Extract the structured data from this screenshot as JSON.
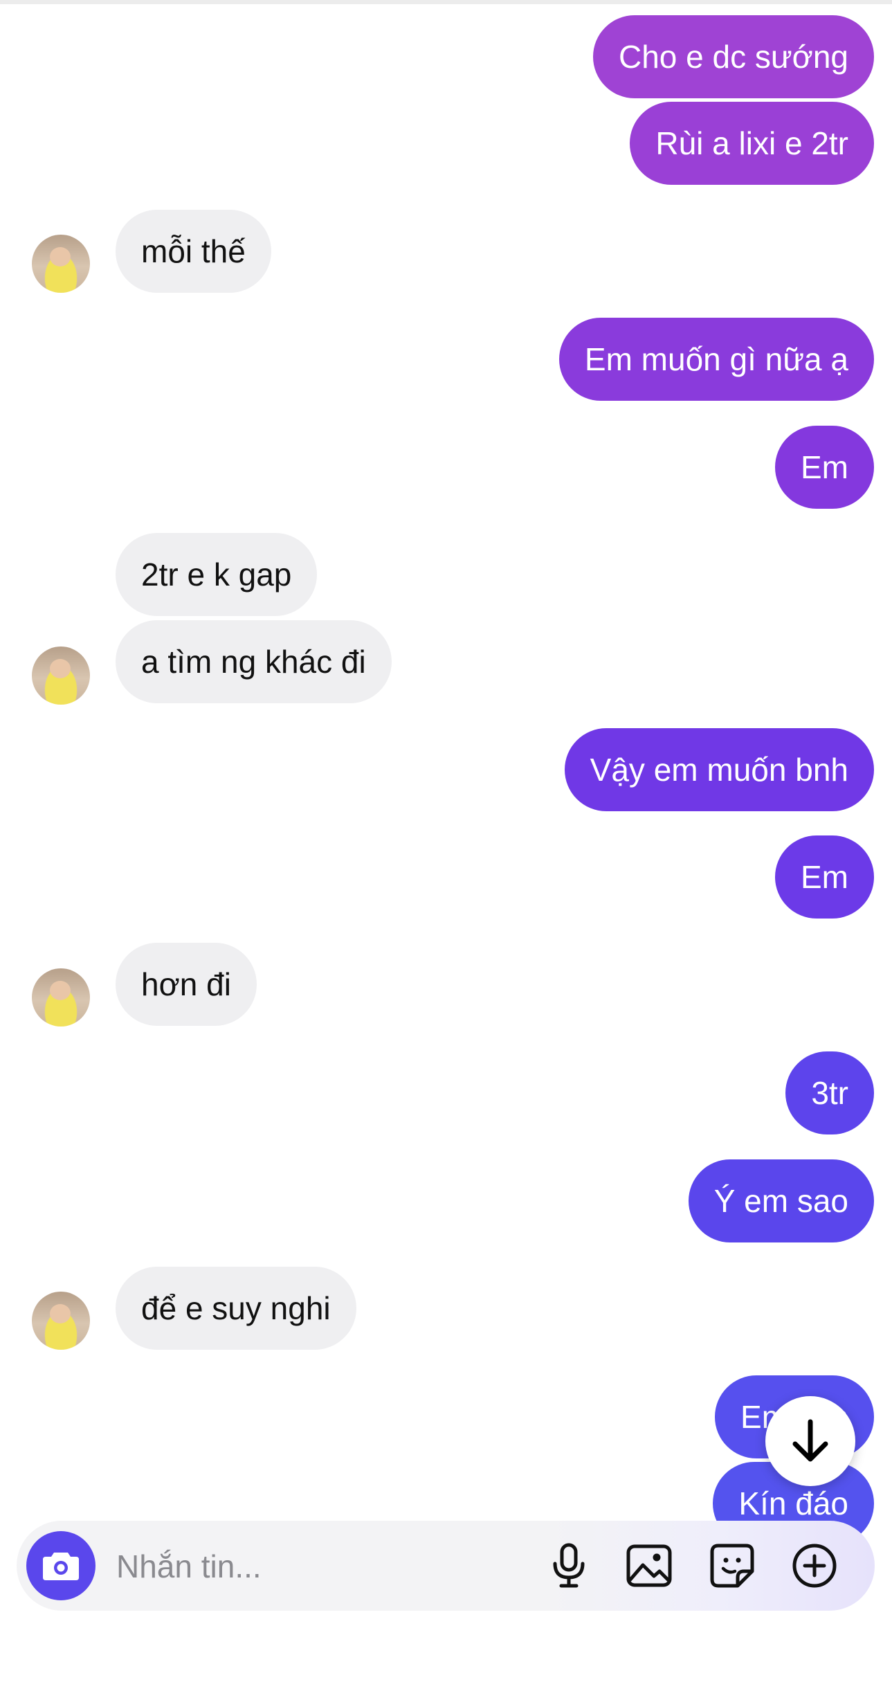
{
  "messages": [
    {
      "side": "sent",
      "text": "Cho e dc sướng",
      "color": "#9f43d4"
    },
    {
      "side": "sent",
      "text": "Rùi a lixi e 2tr",
      "color": "#9a40d6"
    },
    {
      "side": "received",
      "text": "mỗi thế"
    },
    {
      "side": "sent",
      "text": "Em muốn gì nữa ạ",
      "color": "#8a3bdc"
    },
    {
      "side": "sent",
      "text": "Em",
      "color": "#8438de"
    },
    {
      "side": "received",
      "text": "2tr e k gap"
    },
    {
      "side": "received",
      "text": "a tìm ng khác đi"
    },
    {
      "side": "sent",
      "text": "Vậy em muốn bnh",
      "color": "#7038e6"
    },
    {
      "side": "sent",
      "text": "Em",
      "color": "#6c3ae8"
    },
    {
      "side": "received",
      "text": "hơn đi"
    },
    {
      "side": "sent",
      "text": "3tr",
      "color": "#5d44ec"
    },
    {
      "side": "sent",
      "text": "Ý em sao",
      "color": "#5a46ec"
    },
    {
      "side": "received",
      "text": "để e suy nghi"
    },
    {
      "side": "sent",
      "text": "Em yên",
      "color": "#5650ee"
    },
    {
      "side": "sent",
      "text": "Kín đáo",
      "color": "#5453ee"
    }
  ],
  "composer": {
    "placeholder": "Nhắn tin...",
    "accent": "#5a47ec",
    "icons": [
      "camera-icon",
      "microphone-icon",
      "image-icon",
      "sticker-icon",
      "plus-circle-icon"
    ]
  },
  "scroll_button_icon": "arrow-down-icon"
}
